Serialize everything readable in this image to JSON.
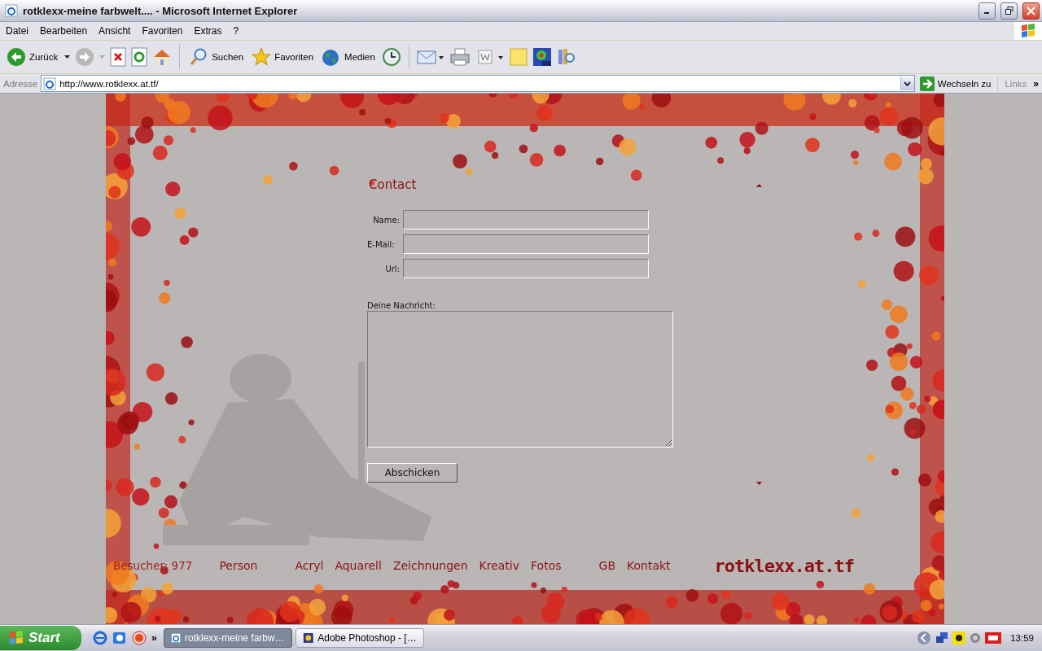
{
  "window": {
    "title": "rotklexx-meine farbwelt.... - Microsoft Internet Explorer"
  },
  "menu": [
    "Datei",
    "Bearbeiten",
    "Ansicht",
    "Favoriten",
    "Extras",
    "?"
  ],
  "toolbar": {
    "back": "Zurück",
    "search": "Suchen",
    "favorites": "Favoriten",
    "media": "Medien"
  },
  "address": {
    "label": "Adresse",
    "value": "http://www.rotklexx.at.tf/",
    "go": "Wechseln zu",
    "links": "Links",
    "more": "»"
  },
  "contact": {
    "heading": "Contact",
    "fields": [
      {
        "label": "Name:"
      },
      {
        "label": "E-Mail:"
      },
      {
        "label": "Url:"
      }
    ],
    "message_label": "Deine Nachricht:",
    "submit": "Abschicken"
  },
  "footer": {
    "visitors": "Besucher: 977",
    "nav_groups": [
      [
        "Person"
      ],
      [
        "Acryl",
        "Aquarell",
        "Zeichnungen",
        "Kreativ",
        "Fotos"
      ],
      [
        "GB",
        "Kontakt"
      ]
    ],
    "logo": "rotklexx.at.tf"
  },
  "taskbar": {
    "start": "Start",
    "more": "»",
    "tasks": [
      {
        "label": "rotklexx-meine farbw…",
        "selected": true
      },
      {
        "label": "Adobe Photoshop - […",
        "selected": false
      }
    ],
    "clock": "13:59"
  }
}
